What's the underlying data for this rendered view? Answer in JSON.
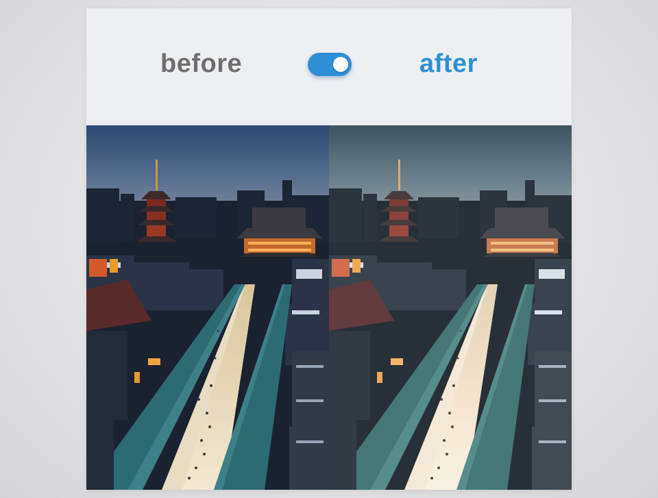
{
  "comparison": {
    "before_label": "before",
    "after_label": "after",
    "toggle_state": "on"
  },
  "colors": {
    "after_accent": "#2f8fd6",
    "before_text": "#6f6f71",
    "header_bg": "#eeeff3"
  },
  "images": {
    "before_description": "",
    "after_description": ""
  }
}
